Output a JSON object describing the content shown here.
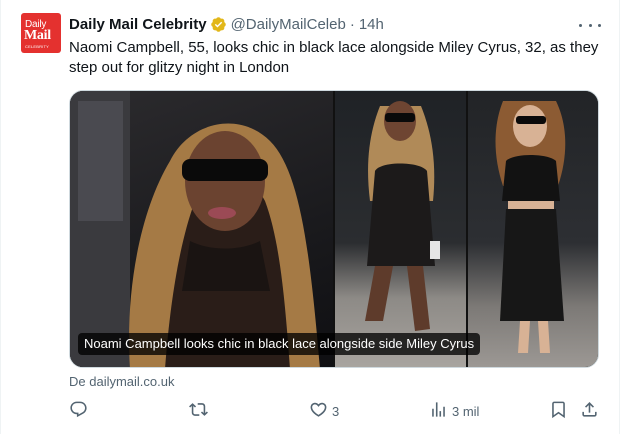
{
  "account": {
    "avatar_text_1": "Daily",
    "avatar_text_2": "Mail",
    "avatar_text_3": "CELEBRITY",
    "name": "Daily Mail Celebrity",
    "verified_icon": "gold-verified-badge-icon",
    "handle": "@DailyMailCeleb",
    "separator": "·",
    "time": "14h"
  },
  "tweet": {
    "text": "Naomi Campbell, 55, looks chic in black lace alongside Miley Cyrus, 32, as they step out for glitzy night in London"
  },
  "media": {
    "caption": "Noami Campbell looks chic in black lace alongside side Miley Cyrus",
    "panels": [
      "photo-left",
      "photo-middle",
      "photo-right"
    ]
  },
  "source": "De dailymail.co.uk",
  "actions": {
    "reply_icon": "reply-icon",
    "retweet_icon": "retweet-icon",
    "like_icon": "heart-icon",
    "like_count": "3",
    "views_icon": "views-icon",
    "views_count": "3 mil",
    "bookmark_icon": "bookmark-icon",
    "share_icon": "share-icon"
  },
  "colors": {
    "brand_red": "#e4312f",
    "verified_gold": "#e2b719",
    "text_primary": "#0f1419",
    "text_secondary": "#536471"
  }
}
